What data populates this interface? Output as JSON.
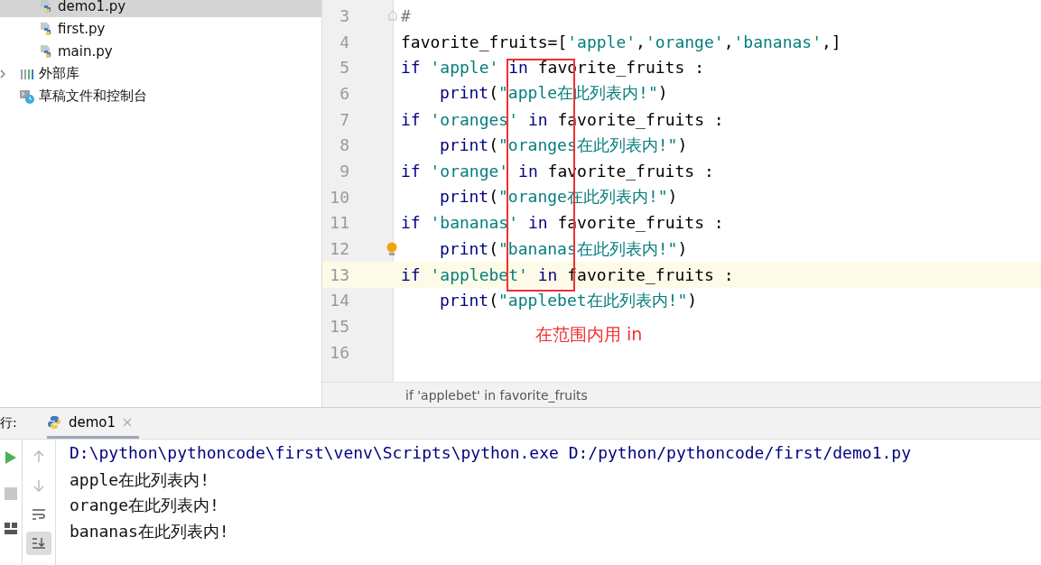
{
  "sidebar": {
    "files": [
      {
        "label": "demo1.py",
        "selected": true
      },
      {
        "label": "first.py",
        "selected": false
      },
      {
        "label": "main.py",
        "selected": false
      }
    ],
    "roots": [
      {
        "label": "外部库",
        "kind": "library",
        "expandable": true
      },
      {
        "label": "草稿文件和控制台",
        "kind": "scratches",
        "expandable": false
      }
    ]
  },
  "editor": {
    "lines": [
      {
        "number": "3",
        "current": false,
        "indented": false,
        "bulb": false,
        "tokens": [
          {
            "kind": "comment",
            "text": "#"
          }
        ]
      },
      {
        "number": "4",
        "current": false,
        "indented": false,
        "bulb": false,
        "tokens": [
          {
            "kind": "plain",
            "text": "favorite_fruits=["
          },
          {
            "kind": "string",
            "text": "'apple'"
          },
          {
            "kind": "plain",
            "text": ","
          },
          {
            "kind": "string",
            "text": "'orange'"
          },
          {
            "kind": "plain",
            "text": ","
          },
          {
            "kind": "string",
            "text": "'bananas'"
          },
          {
            "kind": "plain",
            "text": ",]"
          }
        ]
      },
      {
        "number": "5",
        "current": false,
        "indented": false,
        "bulb": false,
        "tokens": [
          {
            "kind": "keyword",
            "text": "if "
          },
          {
            "kind": "string",
            "text": "'apple'"
          },
          {
            "kind": "keyword",
            "text": " in "
          },
          {
            "kind": "plain",
            "text": "favorite_fruits :"
          }
        ]
      },
      {
        "number": "6",
        "current": false,
        "indented": true,
        "bulb": false,
        "tokens": [
          {
            "kind": "keyword",
            "text": "print"
          },
          {
            "kind": "plain",
            "text": "("
          },
          {
            "kind": "string",
            "text": "\"apple在此列表内!\""
          },
          {
            "kind": "plain",
            "text": ")"
          }
        ]
      },
      {
        "number": "7",
        "current": false,
        "indented": false,
        "bulb": false,
        "tokens": [
          {
            "kind": "keyword",
            "text": "if "
          },
          {
            "kind": "string",
            "text": "'oranges'"
          },
          {
            "kind": "keyword",
            "text": " in "
          },
          {
            "kind": "plain",
            "text": "favorite_fruits :"
          }
        ]
      },
      {
        "number": "8",
        "current": false,
        "indented": true,
        "bulb": false,
        "tokens": [
          {
            "kind": "keyword",
            "text": "print"
          },
          {
            "kind": "plain",
            "text": "("
          },
          {
            "kind": "string",
            "text": "\"oranges在此列表内!\""
          },
          {
            "kind": "plain",
            "text": ")"
          }
        ]
      },
      {
        "number": "9",
        "current": false,
        "indented": false,
        "bulb": false,
        "tokens": [
          {
            "kind": "keyword",
            "text": "if "
          },
          {
            "kind": "string",
            "text": "'orange'"
          },
          {
            "kind": "keyword",
            "text": " in "
          },
          {
            "kind": "plain",
            "text": "favorite_fruits :"
          }
        ]
      },
      {
        "number": "10",
        "current": false,
        "indented": true,
        "bulb": false,
        "tokens": [
          {
            "kind": "keyword",
            "text": "print"
          },
          {
            "kind": "plain",
            "text": "("
          },
          {
            "kind": "string",
            "text": "\"orange在此列表内!\""
          },
          {
            "kind": "plain",
            "text": ")"
          }
        ]
      },
      {
        "number": "11",
        "current": false,
        "indented": false,
        "bulb": false,
        "tokens": [
          {
            "kind": "keyword",
            "text": "if "
          },
          {
            "kind": "string",
            "text": "'bananas'"
          },
          {
            "kind": "keyword",
            "text": " in "
          },
          {
            "kind": "plain",
            "text": "favorite_fruits :"
          }
        ]
      },
      {
        "number": "12",
        "current": false,
        "indented": true,
        "bulb": true,
        "tokens": [
          {
            "kind": "keyword",
            "text": "print"
          },
          {
            "kind": "plain",
            "text": "("
          },
          {
            "kind": "string",
            "text": "\"bananas在此列表内!\""
          },
          {
            "kind": "plain",
            "text": ")"
          }
        ]
      },
      {
        "number": "13",
        "current": true,
        "indented": false,
        "bulb": false,
        "tokens": [
          {
            "kind": "keyword",
            "text": "if "
          },
          {
            "kind": "string",
            "text": "'applebet'"
          },
          {
            "kind": "keyword",
            "text": " in "
          },
          {
            "kind": "plain",
            "text": "favorite_fruits :"
          }
        ]
      },
      {
        "number": "14",
        "current": false,
        "indented": true,
        "bulb": false,
        "tokens": [
          {
            "kind": "keyword",
            "text": "print"
          },
          {
            "kind": "plain",
            "text": "("
          },
          {
            "kind": "string",
            "text": "\"applebet在此列表内!\""
          },
          {
            "kind": "plain",
            "text": ")"
          }
        ]
      },
      {
        "number": "15",
        "current": false,
        "bulb": false
      },
      {
        "number": "16",
        "current": false,
        "bulb": false
      }
    ],
    "annotation": "在范围内用 in",
    "breadcrumb": "if 'applebet' in favorite_fruits"
  },
  "run_panel": {
    "label": "行:",
    "tabs": [
      {
        "label": "demo1",
        "selected": true
      }
    ],
    "output": [
      {
        "kind": "command",
        "text": "D:\\python\\pythoncode\\first\\venv\\Scripts\\python.exe D:/python/pythoncode/first/demo1.py"
      },
      {
        "kind": "stdout",
        "text": "apple在此列表内!"
      },
      {
        "kind": "stdout",
        "text": "orange在此列表内!"
      },
      {
        "kind": "stdout",
        "text": "bananas在此列表内!"
      }
    ]
  }
}
